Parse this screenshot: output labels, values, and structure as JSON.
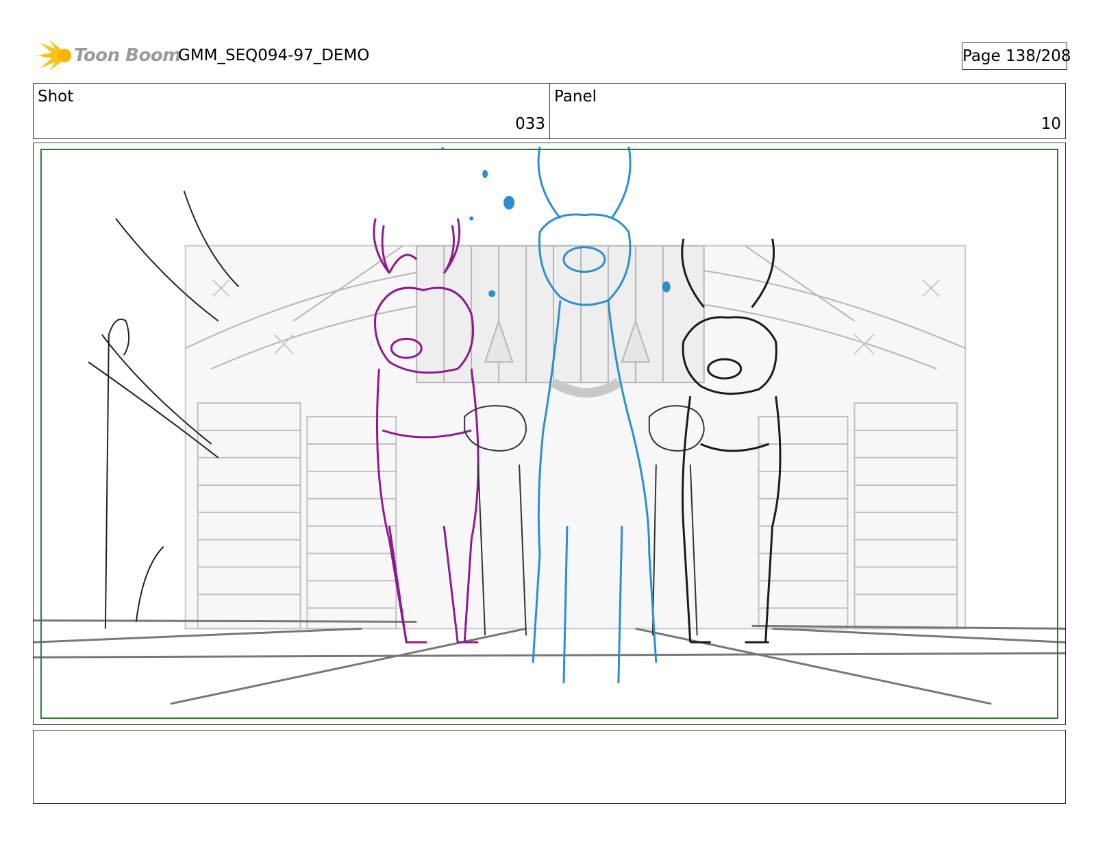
{
  "header": {
    "logo_text": "Toon Boom",
    "project_title": "GMM_SEQ094-97_DEMO",
    "page_label": "Page 138/208"
  },
  "info": {
    "shot_label": "Shot",
    "shot_value": "033",
    "panel_label": "Panel",
    "panel_value": "10"
  },
  "notes": {
    "text": ""
  },
  "colors": {
    "logo_yellow": "#f5c518",
    "logo_gray": "#9a9a9a",
    "safe_frame": "#2f7a2f",
    "reindeer_left": "#8e1a8e",
    "reindeer_center": "#2a8fd0",
    "reindeer_right": "#1a1a1a",
    "background_lines": "#b5b5b5"
  },
  "icons": {
    "logo": "toon-boom-sun-logo-icon"
  }
}
